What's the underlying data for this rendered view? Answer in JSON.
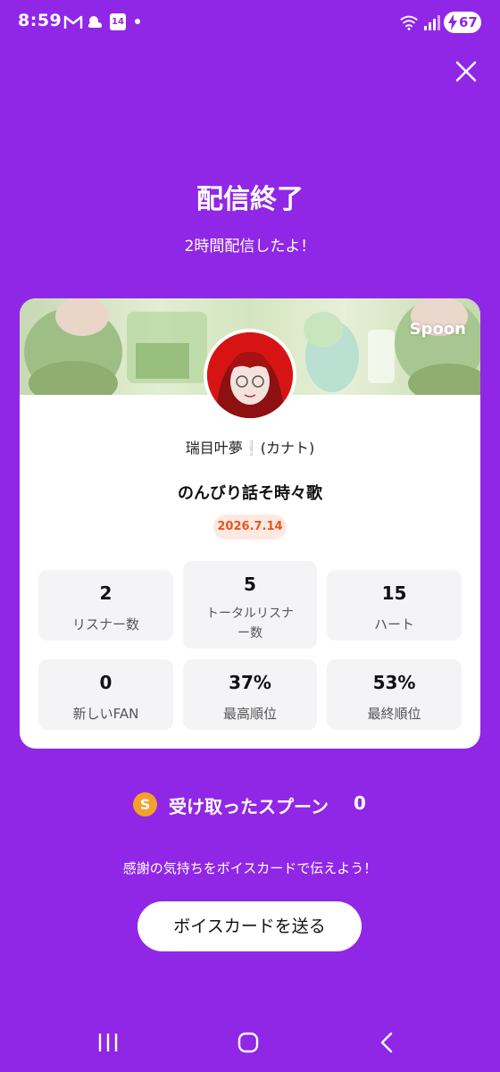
{
  "status_bar": {
    "time": "8:59",
    "calendar_day": "14",
    "battery": "67",
    "icons": [
      "gmail-icon",
      "weather-icon",
      "calendar-icon",
      "notification-dot",
      "wifi-icon",
      "signal-icon",
      "battery-charging-icon"
    ]
  },
  "header": {
    "close_icon": "close-icon",
    "title": "配信終了",
    "subtitle": "2時間配信したよ！"
  },
  "card": {
    "brand": "Spoon",
    "username": "瑞目叶夢❕(カナト)",
    "show_title": "のんびり話そ時々歌",
    "date": "2026.7.14",
    "stats": [
      {
        "value": "2",
        "label": "リスナー数"
      },
      {
        "value": "5",
        "label": "トータルリスナー数"
      },
      {
        "value": "15",
        "label": "ハート"
      },
      {
        "value": "0",
        "label": "新しいFAN"
      },
      {
        "value": "37%",
        "label": "最高順位"
      },
      {
        "value": "53%",
        "label": "最終順位"
      }
    ]
  },
  "spoons": {
    "coin_letter": "S",
    "label": "受け取ったスプーン",
    "count": "0"
  },
  "footer": {
    "thanks": "感謝の気持ちをボイスカードで伝えよう！",
    "voice_card_button": "ボイスカードを送る"
  },
  "nav": [
    "recents-icon",
    "home-icon",
    "back-icon"
  ],
  "colors": {
    "background": "#9127e6",
    "date_badge_bg": "#fde9e2",
    "date_badge_text": "#e9541e",
    "coin": "#f5a02b"
  }
}
